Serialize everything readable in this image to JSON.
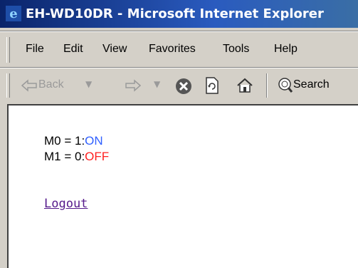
{
  "window": {
    "title": "EH-WD10DR - Microsoft Internet Explorer"
  },
  "menu": {
    "items": [
      "File",
      "Edit",
      "View",
      "Favorites",
      "Tools",
      "Help"
    ]
  },
  "toolbar": {
    "back_label": "Back",
    "search_label": "Search"
  },
  "page": {
    "lines": [
      {
        "prefix": "M0 = 1:",
        "state": "ON",
        "state_color": "#3060ff"
      },
      {
        "prefix": "M1 = 0:",
        "state": "OFF",
        "state_color": "#ff2020"
      }
    ],
    "logout_label": "Logout"
  }
}
